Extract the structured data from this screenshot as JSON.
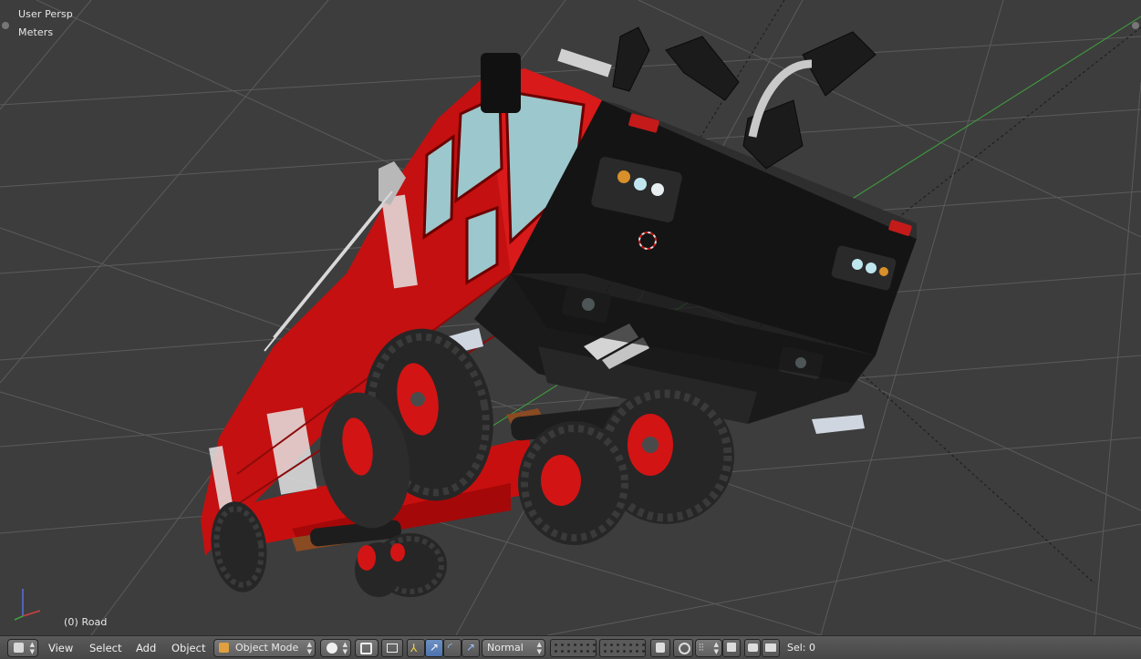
{
  "viewport": {
    "view_name": "User Persp",
    "units": "Meters",
    "active_object": "(0) Road",
    "background_color": "#3d3d3d"
  },
  "header": {
    "menus": [
      "View",
      "Select",
      "Add",
      "Object"
    ],
    "mode": "Object Mode",
    "shading_icon": "solid-sphere-icon",
    "pivot_icon": "pivot-point-icon",
    "manipulator_icons": [
      "translate-icon",
      "rotate-icon",
      "scale-icon"
    ],
    "transform_orientation": "Normal",
    "status": "Sel: 0",
    "accent_color": "#5b7fbb"
  },
  "model": {
    "body_color": "#d01010",
    "chassis_color": "#101010",
    "tire_color": "#2a2a2a",
    "glass_color": "#9cc7cc"
  }
}
